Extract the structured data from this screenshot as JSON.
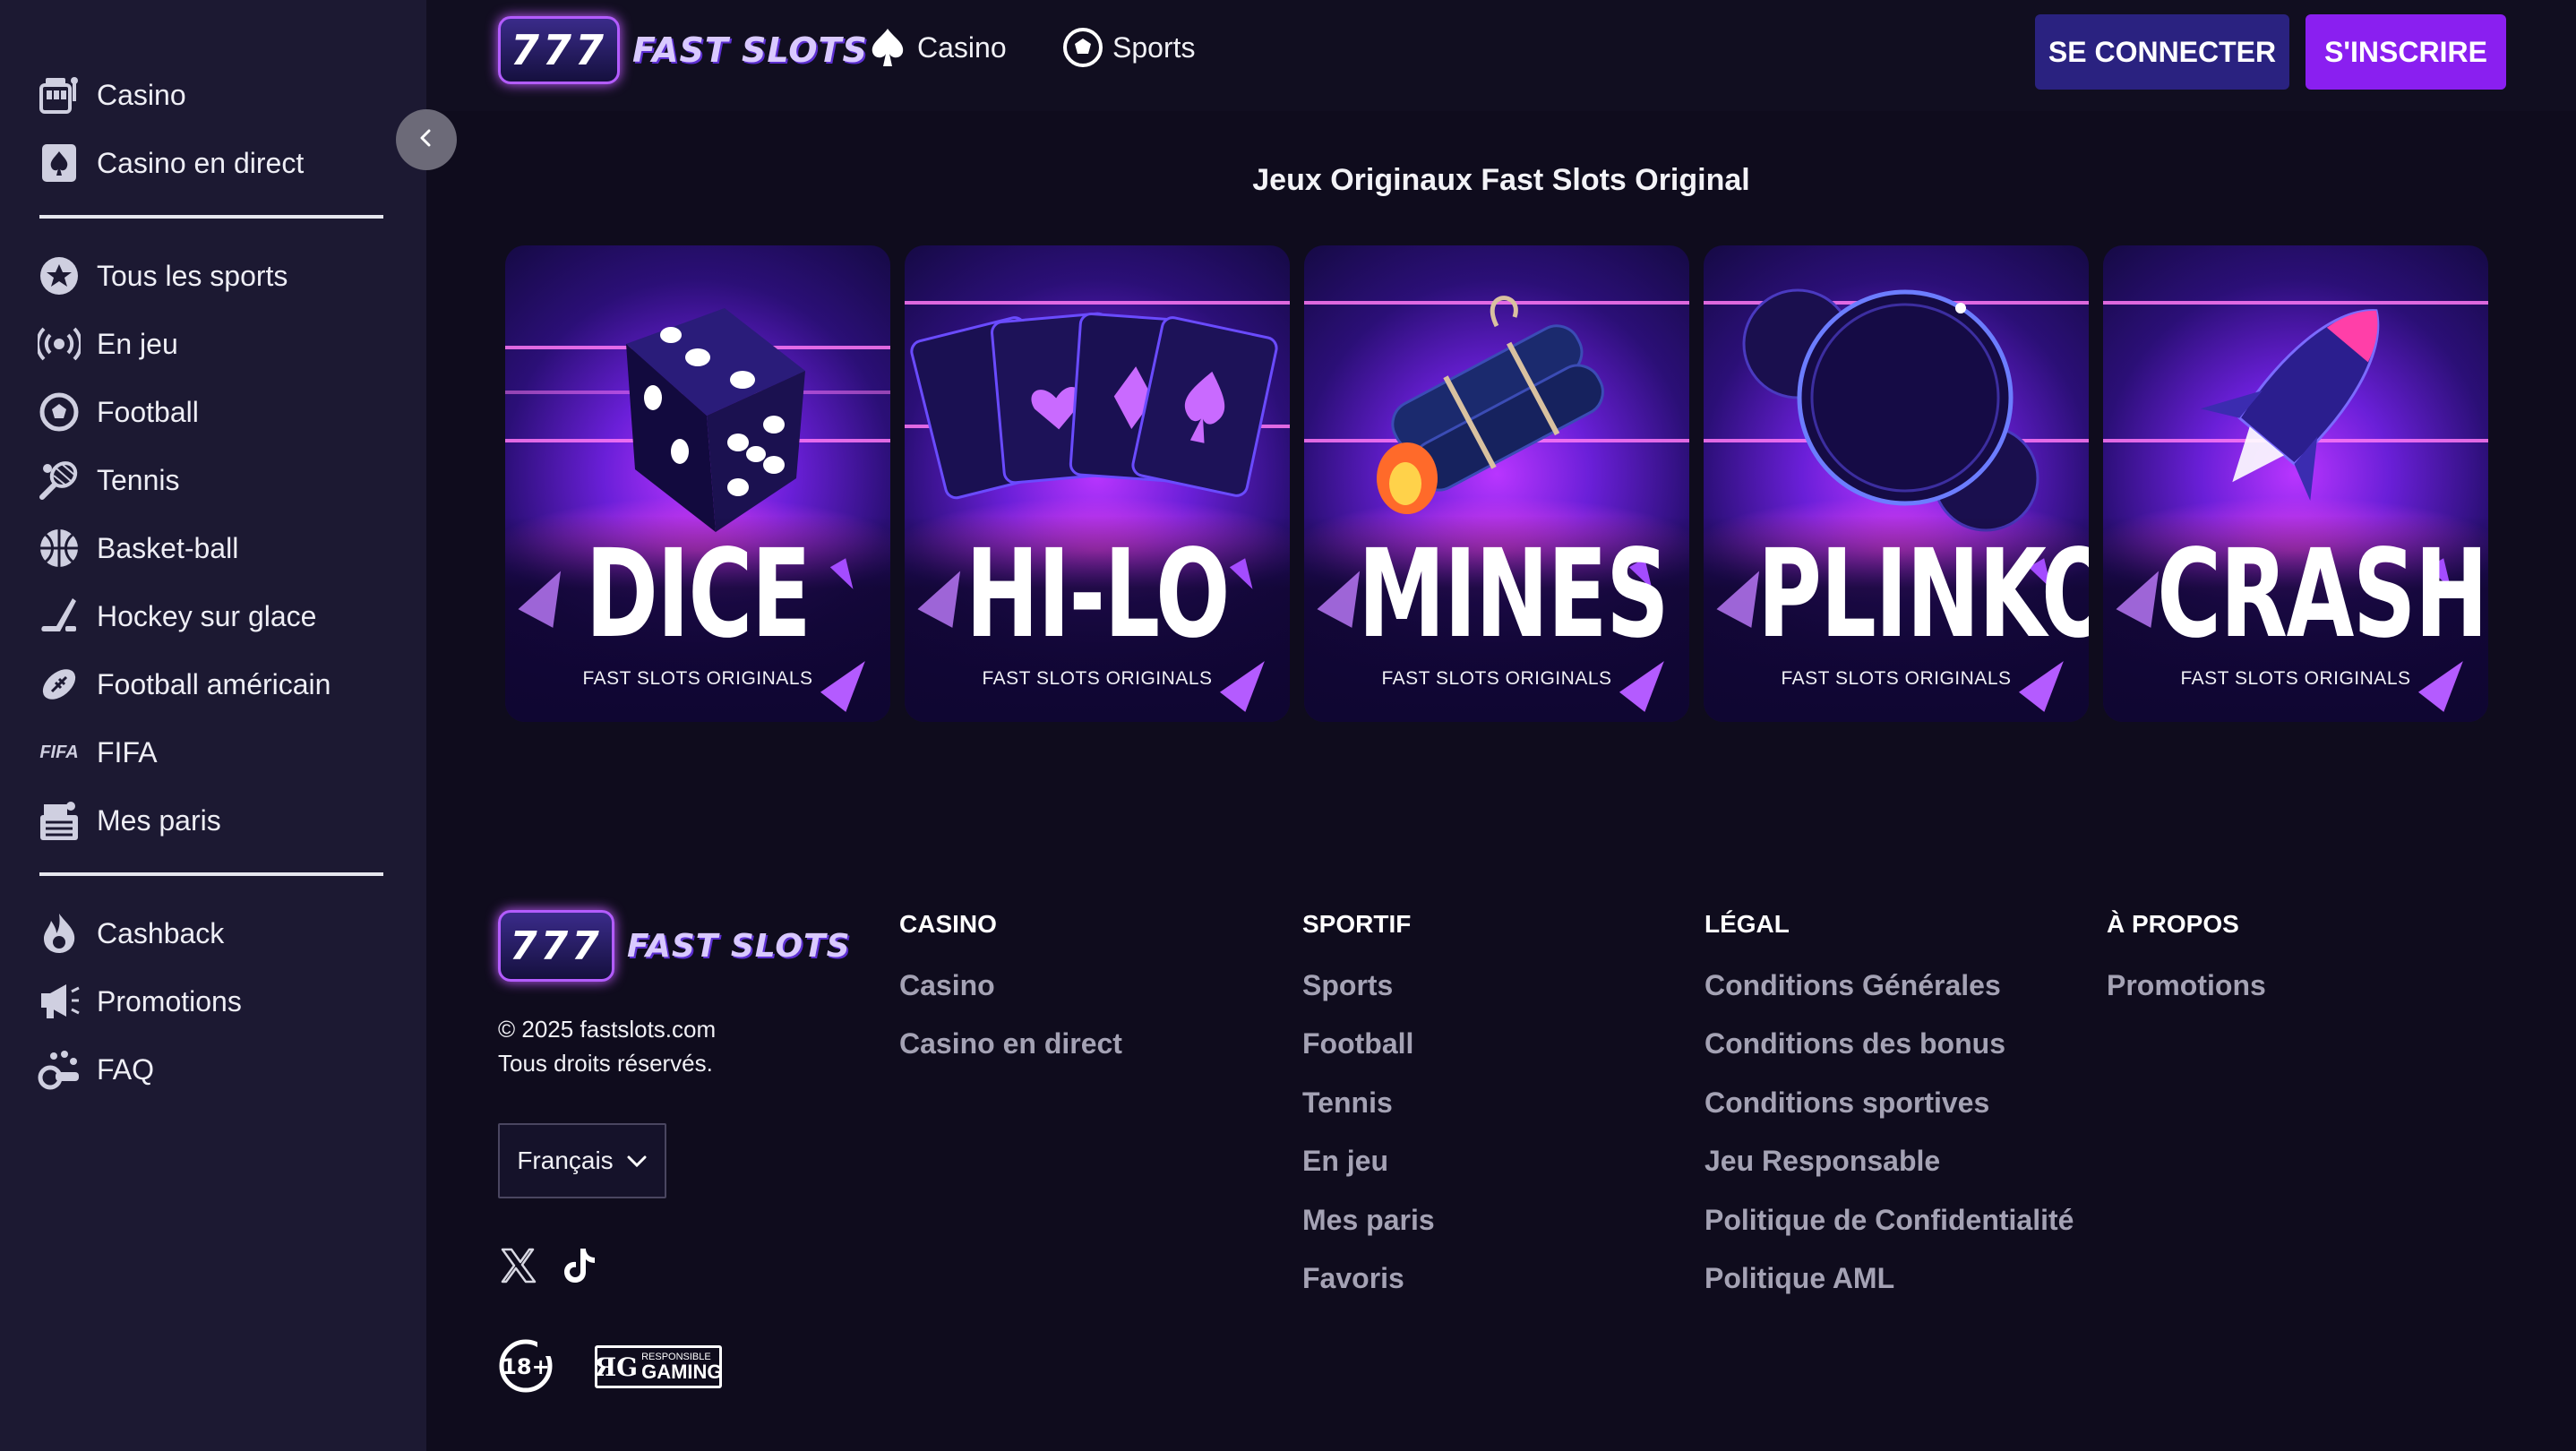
{
  "sidebar": {
    "group1": [
      {
        "label": "Casino",
        "icon": "casino-icon"
      },
      {
        "label": "Casino en direct",
        "icon": "live-casino-icon"
      }
    ],
    "group2": [
      {
        "label": "Tous les sports",
        "icon": "all-sports-icon"
      },
      {
        "label": "En jeu",
        "icon": "live-broadcast-icon"
      },
      {
        "label": "Football",
        "icon": "football-icon"
      },
      {
        "label": "Tennis",
        "icon": "tennis-icon"
      },
      {
        "label": "Basket-ball",
        "icon": "basketball-icon"
      },
      {
        "label": "Hockey sur glace",
        "icon": "ice-hockey-icon"
      },
      {
        "label": "Football américain",
        "icon": "american-football-icon"
      },
      {
        "label": "FIFA",
        "icon": "fifa-icon",
        "icon_text": "FIFA"
      },
      {
        "label": "Mes paris",
        "icon": "my-bets-icon"
      }
    ],
    "group3": [
      {
        "label": "Cashback",
        "icon": "cashback-icon"
      },
      {
        "label": "Promotions",
        "icon": "megaphone-icon"
      },
      {
        "label": "FAQ",
        "icon": "faq-icon"
      }
    ]
  },
  "header": {
    "logo_badge": "777",
    "logo_name": "FAST SLOTS",
    "nav": [
      {
        "label": "Casino",
        "icon": "spade-icon"
      },
      {
        "label": "Sports",
        "icon": "soccer-ball-icon"
      }
    ],
    "login_label": "SE CONNECTER",
    "register_label": "S'INSCRIRE"
  },
  "originals": {
    "title": "Jeux Originaux Fast Slots Original",
    "games": [
      {
        "title": "DICE",
        "subtitle": "FAST SLOTS ORIGINALS",
        "icon": "dice-icon"
      },
      {
        "title": "HI-LO",
        "subtitle": "FAST SLOTS ORIGINALS",
        "icon": "cards-icon"
      },
      {
        "title": "MINES",
        "subtitle": "FAST SLOTS ORIGINALS",
        "icon": "dynamite-icon"
      },
      {
        "title": "PLINKO",
        "subtitle": "FAST SLOTS ORIGINALS",
        "icon": "bubble-icon"
      },
      {
        "title": "CRASH",
        "subtitle": "FAST SLOTS ORIGINALS",
        "icon": "rocket-icon"
      }
    ]
  },
  "footer": {
    "logo_badge": "777",
    "logo_name": "FAST SLOTS",
    "copyright_line1": "© 2025 fastslots.com",
    "copyright_line2": "Tous droits réservés.",
    "language": "Français",
    "badge_18": "18+",
    "rg_small": "RESPONSIBLE",
    "rg_big": "GAMING",
    "columns": [
      {
        "heading": "CASINO",
        "links": [
          "Casino",
          "Casino en direct"
        ]
      },
      {
        "heading": "SPORTIF",
        "links": [
          "Sports",
          "Football",
          "Tennis",
          "En jeu",
          "Mes paris",
          "Favoris"
        ]
      },
      {
        "heading": "LÉGAL",
        "links": [
          "Conditions Générales",
          "Conditions des bonus",
          "Conditions sportives",
          "Jeu Responsable",
          "Politique de Confidentialité",
          "Politique AML"
        ]
      },
      {
        "heading": "À PROPOS",
        "links": [
          "Promotions"
        ]
      }
    ]
  },
  "colors": {
    "sidebar_bg": "#1c1932",
    "page_bg": "#0f0c1d",
    "login_bg": "#2a2280",
    "register_bg": "#8a1ff0",
    "footer_link": "#a4a2b4"
  }
}
